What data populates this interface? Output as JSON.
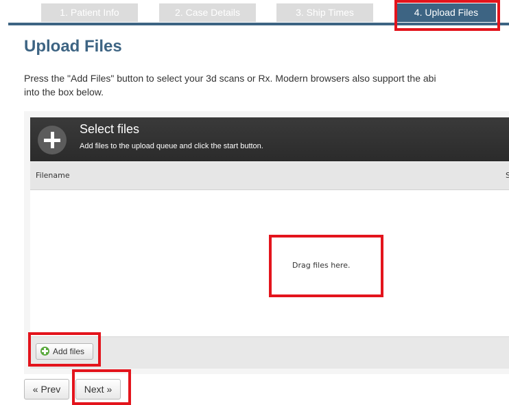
{
  "wizard": {
    "tabs": [
      {
        "label": "1. Patient Info"
      },
      {
        "label": "2. Case Details"
      },
      {
        "label": "3. Ship Times"
      },
      {
        "label": "4. Upload Files"
      }
    ]
  },
  "page": {
    "title": "Upload Files",
    "instructions_line1": "Press the \"Add Files\" button to select your 3d scans or Rx. Modern browsers also support the abi",
    "instructions_line2": "into the box below."
  },
  "uploader": {
    "header_title": "Select files",
    "header_subtitle": "Add files to the upload queue and click the start button.",
    "columns": [
      "Filename",
      "S"
    ],
    "drop_text": "Drag files here.",
    "add_files_label": "Add files"
  },
  "pager": {
    "prev_label": "« Prev",
    "next_label": "Next »"
  },
  "colors": {
    "accent": "#3d6483",
    "highlight": "#e3141c",
    "header_bg": "#2b2b2b",
    "tab_inactive": "#dcdcdc"
  },
  "icons": {
    "add_circle": "plus-circle-icon",
    "add_files": "green-plus-icon"
  }
}
